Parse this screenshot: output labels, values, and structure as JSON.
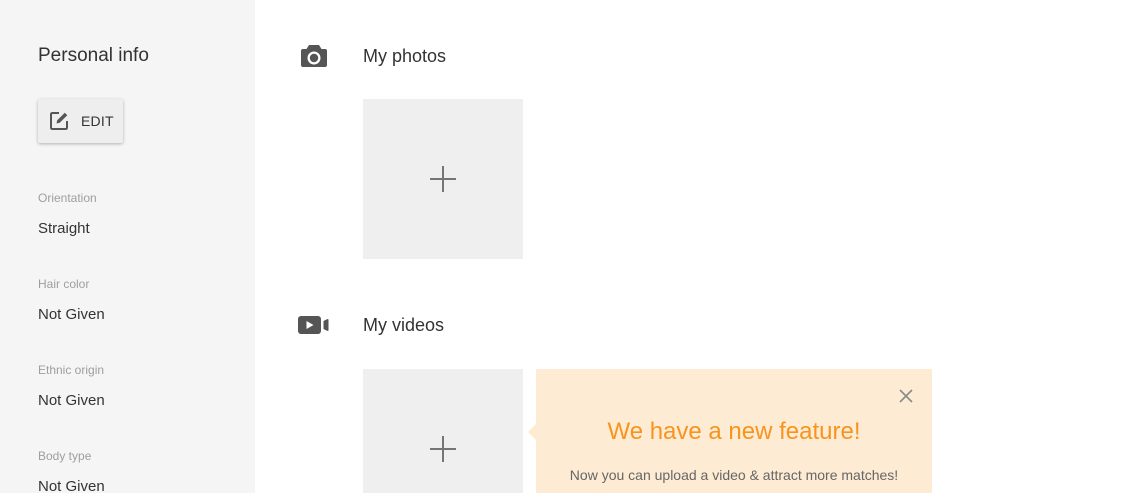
{
  "sidebar": {
    "title": "Personal info",
    "edit_button": {
      "label": "EDIT",
      "icon": "edit-icon"
    },
    "fields": [
      {
        "label": "Orientation",
        "value": "Straight"
      },
      {
        "label": "Hair color",
        "value": "Not Given"
      },
      {
        "label": "Ethnic origin",
        "value": "Not Given"
      },
      {
        "label": "Body type",
        "value": "Not Given"
      }
    ]
  },
  "main": {
    "photos": {
      "title": "My photos",
      "icon": "camera-icon",
      "add_icon": "plus-icon"
    },
    "videos": {
      "title": "My videos",
      "icon": "video-camera-icon",
      "add_icon": "plus-icon"
    }
  },
  "popover": {
    "title": "We have a new feature!",
    "message": "Now you can upload a video & attract more matches!",
    "close_icon": "close-icon"
  },
  "colors": {
    "accent": "#f7941d",
    "popover_background": "#fdebd3",
    "sidebar_background": "#f5f5f5",
    "tile_background": "#efefef"
  }
}
